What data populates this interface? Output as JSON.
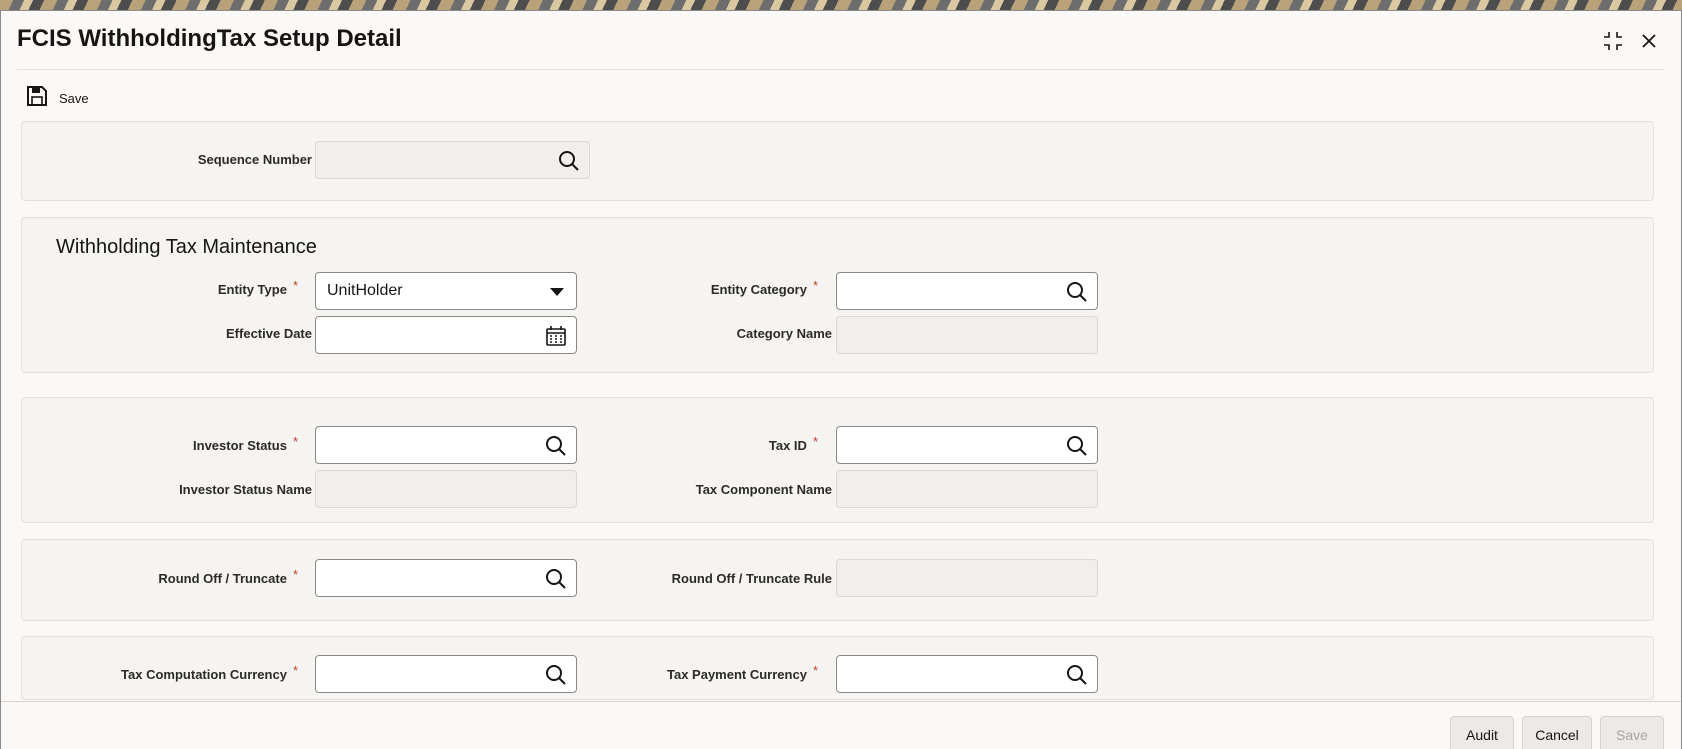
{
  "window": {
    "title": "FCIS WithholdingTax Setup Detail"
  },
  "toolbar": {
    "save_label": "Save"
  },
  "sequence": {
    "label": "Sequence Number",
    "value": ""
  },
  "maintenance": {
    "section_title": "Withholding Tax Maintenance",
    "entity_type_label": "Entity Type",
    "entity_type_value": "UnitHolder",
    "entity_category_label": "Entity Category",
    "entity_category_value": "",
    "effective_date_label": "Effective Date",
    "effective_date_value": "",
    "category_name_label": "Category Name",
    "category_name_value": ""
  },
  "investor": {
    "investor_status_label": "Investor Status",
    "investor_status_value": "",
    "tax_id_label": "Tax ID",
    "tax_id_value": "",
    "investor_status_name_label": "Investor Status Name",
    "investor_status_name_value": "",
    "tax_component_name_label": "Tax Component Name",
    "tax_component_name_value": ""
  },
  "rounding": {
    "round_off_label": "Round Off / Truncate",
    "round_off_value": "",
    "round_off_rule_label": "Round Off / Truncate Rule",
    "round_off_rule_value": ""
  },
  "currency": {
    "tax_computation_currency_label": "Tax Computation Currency",
    "tax_computation_currency_value": "",
    "tax_payment_currency_label": "Tax Payment Currency",
    "tax_payment_currency_value": ""
  },
  "required_marker": "*",
  "footer": {
    "audit_label": "Audit",
    "cancel_label": "Cancel",
    "save_label": "Save"
  },
  "icons": {
    "search": "search-icon",
    "calendar": "calendar-icon",
    "dropdown": "chevron-down-icon",
    "save": "save-icon",
    "expand": "expand-icon",
    "close": "close-icon"
  },
  "colors": {
    "required": "#c0402c",
    "background": "#fbf9f8",
    "panel": "#f5f4f2"
  }
}
